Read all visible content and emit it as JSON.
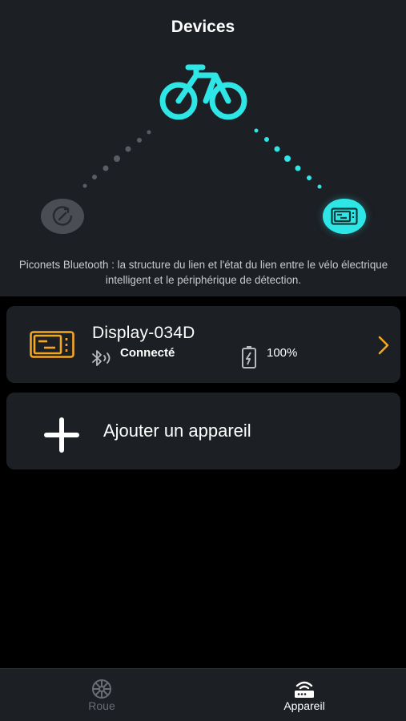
{
  "header": {
    "title": "Devices",
    "description": "Piconets Bluetooth : la structure du lien et l'état du lien entre le vélo électrique intelligent et le périphérique de détection."
  },
  "topology": {
    "center_icon": "bicycle-icon",
    "left_node_icon": "wheel-sensor-icon",
    "right_node_icon": "display-device-icon",
    "left_link_color": "#5a5e64",
    "right_link_color": "#2ee6e6",
    "accent_color": "#2ee6e6"
  },
  "devices": [
    {
      "name": "Display-034D",
      "status": "Connecté",
      "battery": "100%",
      "icon": "display-device-icon",
      "icon_color": "#f5a623"
    }
  ],
  "add_device": {
    "label": "Ajouter un appareil",
    "icon": "plus-icon"
  },
  "bottom_nav": {
    "items": [
      {
        "label": "Roue",
        "icon": "wheel-icon",
        "active": false
      },
      {
        "label": "Appareil",
        "icon": "router-icon",
        "active": true
      }
    ]
  }
}
